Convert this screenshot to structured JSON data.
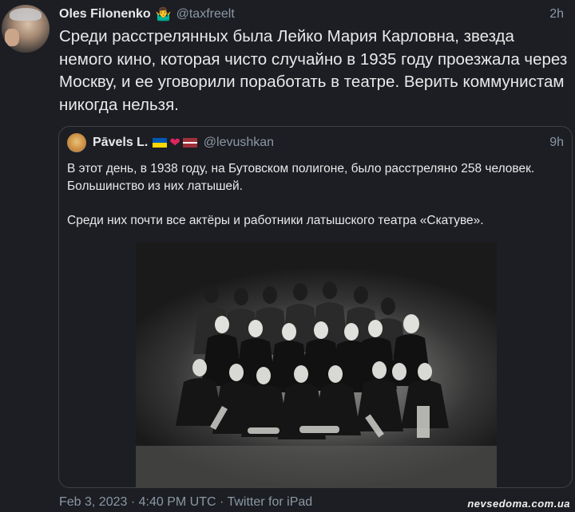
{
  "tweet": {
    "author_name": "Oles Filonenko",
    "author_emoji": "🤷‍♂️",
    "handle": "@taxfreelt",
    "time": "2h",
    "text": "Среди расстрелянных была Лейко Мария Карловна, звезда немого кино, которая чисто случайно в 1935 году проезжала через Москву, и ее уговорили поработать в театре. Верить коммунистам никогда нельзя."
  },
  "quote": {
    "author_name": "Pāvels L.",
    "handle": "@levushkan",
    "time": "9h",
    "paragraph_1": "В этот день,  в 1938 году, на Бутовском полигоне, было расстреляно 258 человек. Большинство из них латышей.",
    "paragraph_2": "Среди них почти все актёры и работники латышского театра «Скатуве»."
  },
  "footer": {
    "meta": "Feb 3, 2023 · 4:40 PM UTC · Twitter for iPad"
  },
  "watermark": "nevsedoma.com.ua"
}
